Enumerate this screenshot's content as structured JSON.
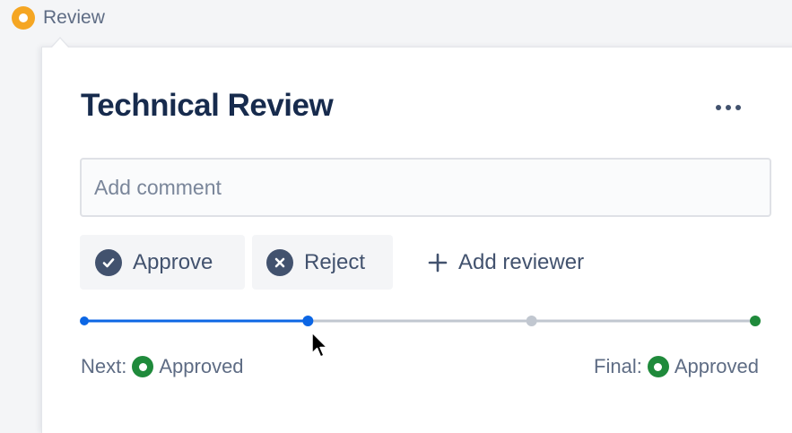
{
  "status": {
    "label": "Review",
    "color": "#f5a623"
  },
  "card": {
    "title": "Technical Review",
    "more_icon": "more-horizontal-icon",
    "comment": {
      "placeholder": "Add comment",
      "value": ""
    },
    "actions": {
      "approve": {
        "label": "Approve",
        "icon": "check-circle-icon"
      },
      "reject": {
        "label": "Reject",
        "icon": "cross-circle-icon"
      },
      "add_reviewer": {
        "label": "Add reviewer",
        "icon": "plus-icon"
      }
    },
    "progress": {
      "steps": 4,
      "completed_fraction": 0.333,
      "active_color": "#0c66e4",
      "inactive_color": "#c1c7d0",
      "final_color": "#1f8a3b"
    },
    "footer": {
      "next_label": "Next:",
      "next_value": "Approved",
      "final_label": "Final:",
      "final_value": "Approved",
      "approved_color": "#1f8a3b"
    }
  }
}
